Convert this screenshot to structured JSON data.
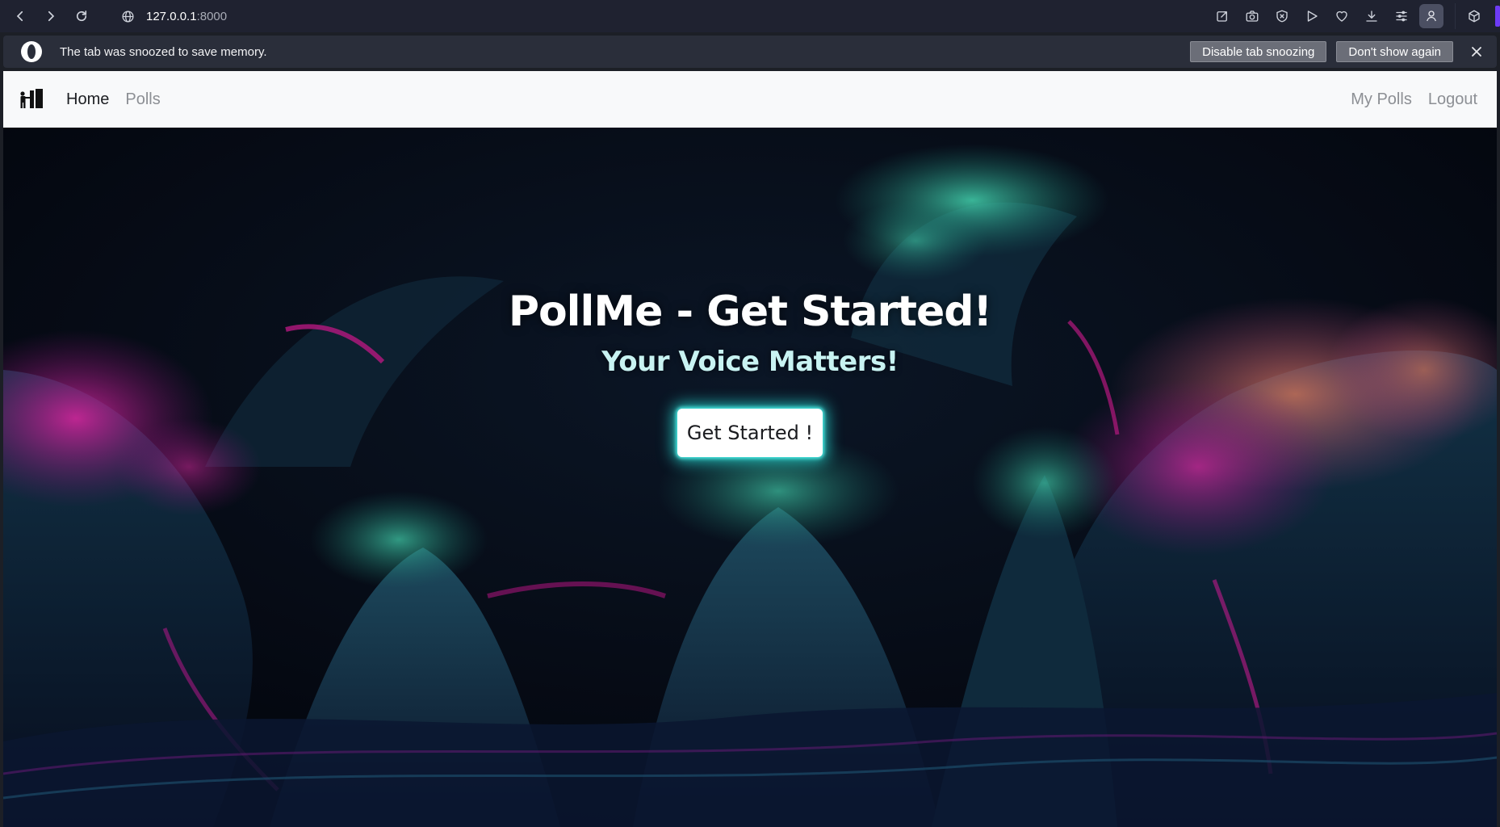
{
  "browser": {
    "url_host": "127.0.0.1",
    "url_port": ":8000",
    "toolbar_icons": [
      "snapshot-share-icon",
      "camera-icon",
      "shield-icon",
      "play-icon",
      "heart-icon",
      "download-icon",
      "easy-setup-icon",
      "profile-icon",
      "extensions-cube-icon"
    ]
  },
  "snooze": {
    "message": "The tab was snoozed to save memory.",
    "disable_label": "Disable tab snoozing",
    "dismiss_label": "Don't show again"
  },
  "site": {
    "nav": {
      "home": "Home",
      "polls": "Polls",
      "my_polls": "My Polls",
      "logout": "Logout"
    },
    "hero": {
      "title": "PollMe - Get Started!",
      "subtitle": "Your Voice Matters!",
      "cta_label": "Get Started !"
    }
  },
  "colors": {
    "chrome_bg": "#1f2230",
    "snooze_bg": "#2a2e3a",
    "navbar_bg": "#f8f9fa",
    "hero_teal": "#2fb89a",
    "hero_magenta": "#c0148f",
    "cta_glow": "#28e6dc"
  }
}
